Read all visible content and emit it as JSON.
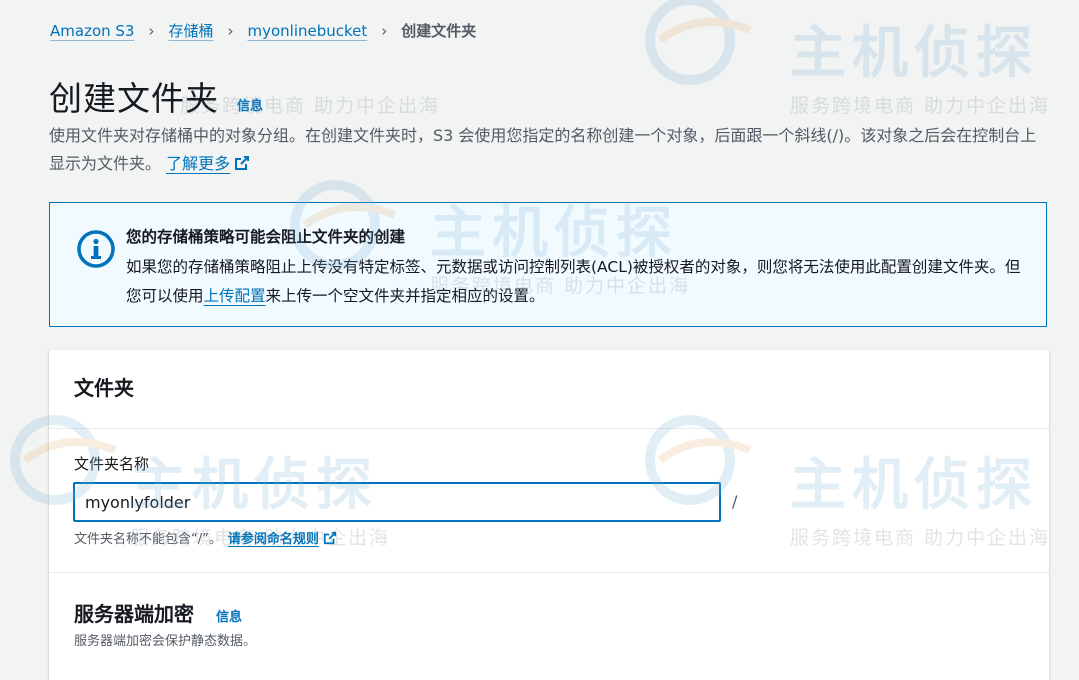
{
  "breadcrumb": {
    "items": [
      "Amazon S3",
      "存储桶",
      "myonlinebucket"
    ],
    "current": "创建文件夹",
    "separator": "›"
  },
  "page": {
    "title": "创建文件夹",
    "info": "信息",
    "description": "使用文件夹对存储桶中的对象分组。在创建文件夹时，S3 会使用您指定的名称创建一个对象，后面跟一个斜线(/)。该对象之后会在控制台上显示为文件夹。",
    "learn_more": "了解更多"
  },
  "alert": {
    "title": "您的存储桶策略可能会阻止文件夹的创建",
    "body_before": "如果您的存储桶策略阻止上传没有特定标签、元数据或访问控制列表(ACL)被授权者的对象，则您将无法使用此配置创建文件夹。但您可以使用",
    "link": "上传配置",
    "body_after": "来上传一个空文件夹并指定相应的设置。"
  },
  "folder_panel": {
    "header": "文件夹",
    "field_label": "文件夹名称",
    "field_value": "myonlyfolder",
    "suffix": "/",
    "hint": "文件夹名称不能包含“/”。",
    "hint_link": "请参阅命名规则"
  },
  "encryption": {
    "title": "服务器端加密",
    "info": "信息",
    "description": "服务器端加密会保护静态数据。"
  },
  "watermark": {
    "main": "主机侦探",
    "sub": "服务跨境电商 助力中企出海"
  },
  "colors": {
    "link": "#0073bb",
    "alert_bg": "#f1faff",
    "background": "#f2f3f3",
    "text": "#16191f"
  }
}
